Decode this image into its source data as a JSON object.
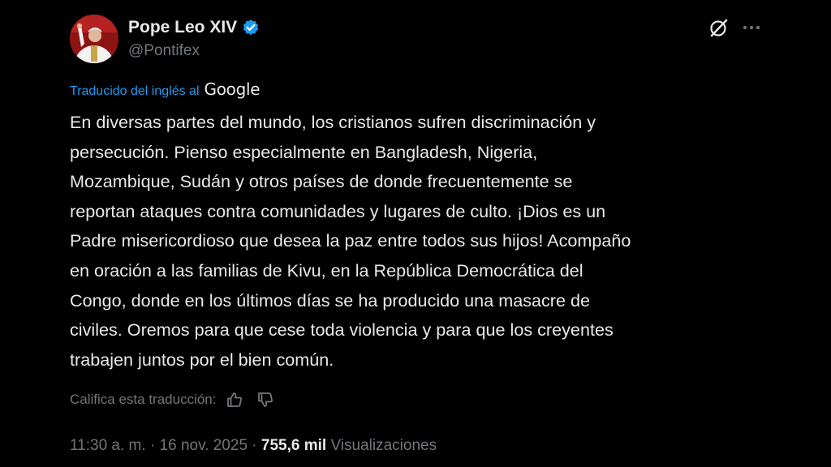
{
  "colors": {
    "background": "#000000",
    "primary_text": "#e7e9ea",
    "secondary_text": "#71767b",
    "link_blue": "#1d9bf0",
    "verified_badge": "#1d9bf0"
  },
  "author": {
    "display_name": "Pope Leo XIV",
    "handle": "@Pontifex",
    "verified": true,
    "avatar_icon": "profile-photo"
  },
  "header_actions": {
    "grok_icon": "grok-icon",
    "more_icon": "more-horizontal-icon"
  },
  "translation": {
    "label": "Traducido del inglés al",
    "provider": "Google"
  },
  "tweet": {
    "lines": [
      "En diversas partes del mundo, los cristianos sufren discriminación y",
      "persecución. Pienso especialmente en Bangladesh, Nigeria,",
      "Mozambique, Sudán y otros países de donde frecuentemente se",
      "reportan ataques contra comunidades y lugares de culto. ¡Dios es un",
      "Padre misericordioso que desea la paz entre todos sus hijos! Acompaño",
      "en oración a las familias de Kivu, en la República Democrática del",
      "Congo, donde en los últimos días se ha producido una masacre de",
      "civiles. Oremos para que cese toda violencia y para que los creyentes",
      "trabajen juntos por el bien común."
    ]
  },
  "rating": {
    "label": "Califica esta traducción:",
    "thumbs_up_icon": "thumbs-up-icon",
    "thumbs_down_icon": "thumbs-down-icon"
  },
  "meta": {
    "time": "11:30 a. m.",
    "separator": " · ",
    "date": "16 nov. 2025",
    "views_count": "755,6 mil",
    "views_label": "Visualizaciones"
  }
}
